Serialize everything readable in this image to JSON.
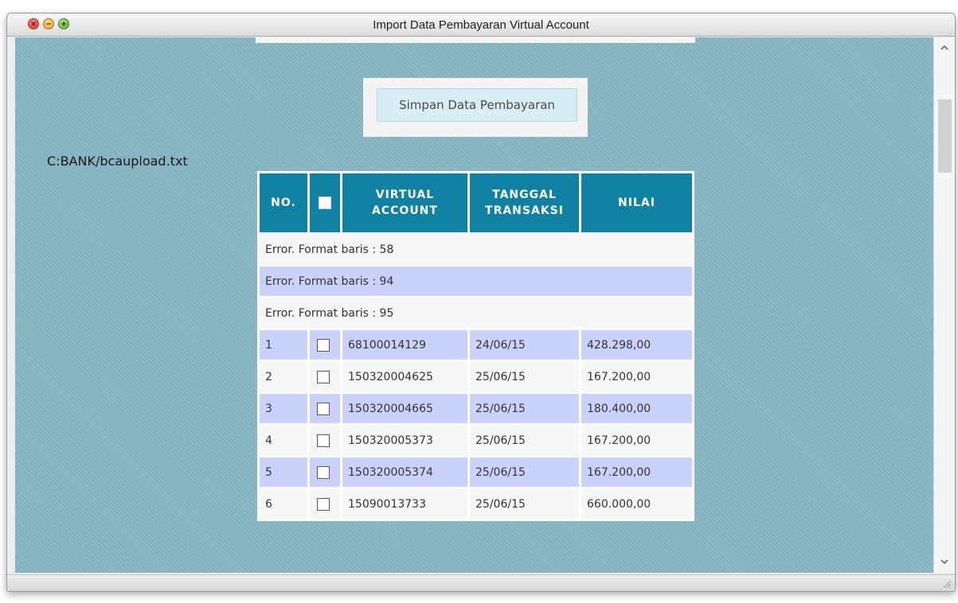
{
  "window": {
    "title": "Import Data Pembayaran Virtual Account"
  },
  "page": {
    "save_button_label": "Simpan Data Pembayaran",
    "file_path": "C:BANK/bcaupload.txt"
  },
  "table": {
    "headers": {
      "no": "NO.",
      "virtual_account": [
        "VIRTUAL",
        "ACCOUNT"
      ],
      "tanggal": [
        "TANGGAL",
        "TRANSAKSI"
      ],
      "nilai": "NILAI"
    },
    "errors": [
      "Error. Format baris : 58",
      "Error. Format baris : 94",
      "Error. Format baris : 95"
    ],
    "rows": [
      {
        "no": "1",
        "va": "68100014129",
        "date": "24/06/15",
        "amount": "428.298,00",
        "checked": false
      },
      {
        "no": "2",
        "va": "150320004625",
        "date": "25/06/15",
        "amount": "167.200,00",
        "checked": false
      },
      {
        "no": "3",
        "va": "150320004665",
        "date": "25/06/15",
        "amount": "180.400,00",
        "checked": false
      },
      {
        "no": "4",
        "va": "150320005373",
        "date": "25/06/15",
        "amount": "167.200,00",
        "checked": false
      },
      {
        "no": "5",
        "va": "150320005374",
        "date": "25/06/15",
        "amount": "167.200,00",
        "checked": false
      },
      {
        "no": "6",
        "va": "15090013733",
        "date": "25/06/15",
        "amount": "660.000,00",
        "checked": false
      }
    ]
  },
  "colors": {
    "background": "#86b5c2",
    "header": "#1181a3",
    "row_alt": "#c9d2fb",
    "row": "#f6f6f6"
  },
  "icons": [
    "close-icon",
    "minimize-icon",
    "zoom-icon",
    "scroll-up-icon",
    "scroll-down-icon",
    "resize-grip-icon"
  ]
}
